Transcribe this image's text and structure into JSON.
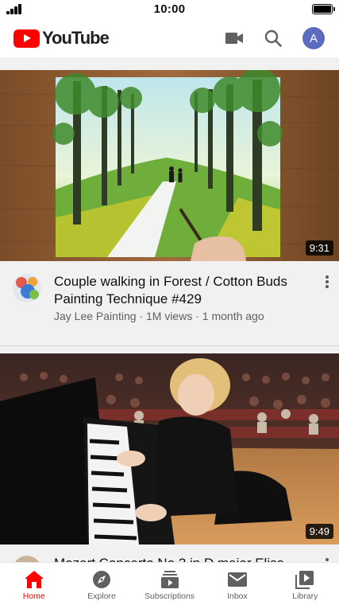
{
  "status_bar": {
    "time": "10:00"
  },
  "header": {
    "brand": "YouTube",
    "account_initial": "A"
  },
  "videos": [
    {
      "title": "Couple walking in Forest / Cotton Buds Painting Technique #429",
      "channel": "Jay Lee Painting",
      "views": "1M views",
      "age": "1 month ago",
      "duration": "9:31"
    },
    {
      "title": "Mozart Concerto No 2 in D major Elisa...",
      "channel": "",
      "views": "",
      "age": "",
      "duration": "9:49"
    }
  ],
  "bottom_nav": [
    {
      "label": "Home",
      "icon": "home-icon",
      "active": true
    },
    {
      "label": "Explore",
      "icon": "compass-icon",
      "active": false
    },
    {
      "label": "Subscriptions",
      "icon": "subscriptions-icon",
      "active": false
    },
    {
      "label": "Inbox",
      "icon": "mail-icon",
      "active": false
    },
    {
      "label": "Library",
      "icon": "library-icon",
      "active": false
    }
  ],
  "colors": {
    "brand_red": "#ff0000",
    "account_blue": "#5c6bc0",
    "text_secondary": "#606060"
  }
}
